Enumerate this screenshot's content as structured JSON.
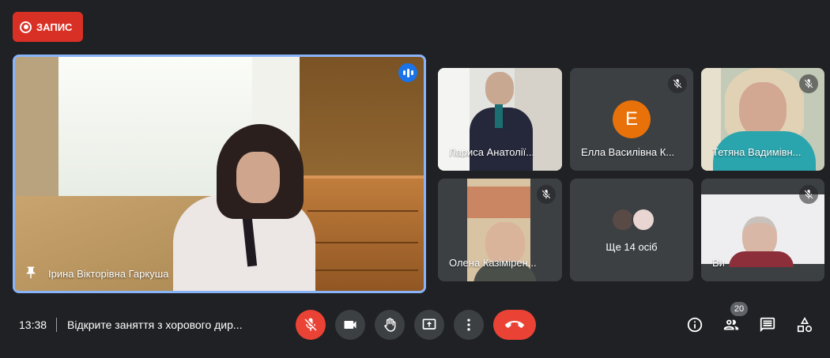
{
  "recording": {
    "label": "ЗАПИС",
    "icon": "record-icon",
    "color": "#d93025"
  },
  "main_tile": {
    "name": "Ірина Вікторівна Гаркуша",
    "pinned": true,
    "speaking": true,
    "border_color": "#8ab4f8"
  },
  "tiles": [
    {
      "name": "Лариса Анатолії...",
      "muted": false,
      "type": "video"
    },
    {
      "name": "Елла Василівна К...",
      "muted": true,
      "type": "avatar",
      "avatar_letter": "E",
      "avatar_color": "#e8710a"
    },
    {
      "name": "Тетяна Вадимівн...",
      "muted": true,
      "type": "video"
    },
    {
      "name": "Олена Казімірен...",
      "muted": true,
      "type": "video"
    },
    {
      "more_label": "Ще 14 осіб",
      "type": "more"
    },
    {
      "name": "Ви",
      "muted": true,
      "type": "video"
    }
  ],
  "bottom_bar": {
    "time": "13:38",
    "meeting_title": "Відкрите заняття з хорового дир...",
    "participant_count": "20",
    "controls": [
      "microphone-off-icon",
      "camera-icon",
      "raise-hand-icon",
      "present-screen-icon",
      "more-options-icon",
      "end-call-icon"
    ],
    "right_icons": [
      "info-icon",
      "people-icon",
      "chat-icon",
      "activities-icon"
    ],
    "danger_color": "#ea4335"
  }
}
